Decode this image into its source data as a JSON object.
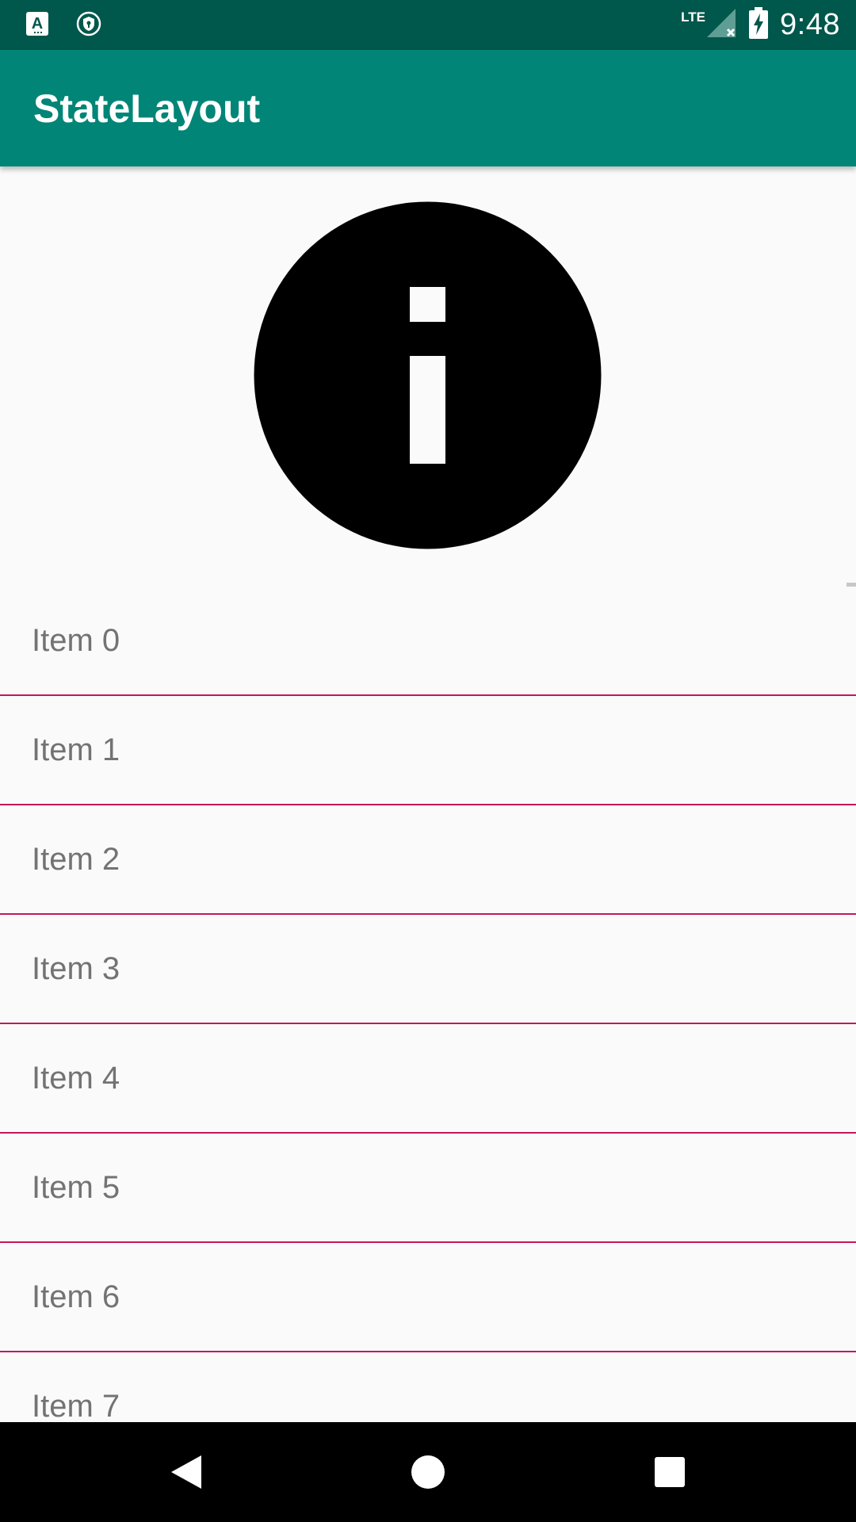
{
  "status_bar": {
    "time": "9:48",
    "network": "LTE",
    "left_icons": [
      "keyboard-a-icon",
      "vpn-shield-icon"
    ],
    "right_icons": [
      "signal-no-data-icon",
      "battery-charging-icon"
    ]
  },
  "app_bar": {
    "title": "StateLayout",
    "color": "#008577"
  },
  "state_view": {
    "icon": "info-icon"
  },
  "list": {
    "divider_color": "#c2185b",
    "items": [
      "Item 0",
      "Item 1",
      "Item 2",
      "Item 3",
      "Item 4",
      "Item 5",
      "Item 6",
      "Item 7"
    ]
  },
  "nav_bar": {
    "buttons": [
      "back-icon",
      "home-icon",
      "recents-icon"
    ]
  }
}
